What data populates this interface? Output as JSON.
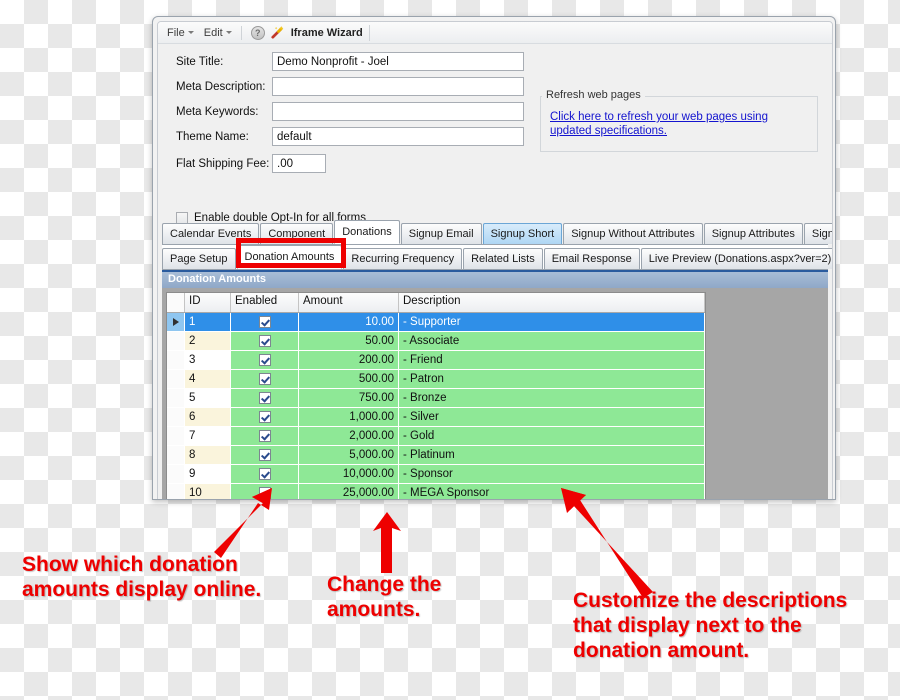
{
  "window": {
    "menu": {
      "file_label": "File",
      "edit_label": "Edit",
      "help_icon_label": "?",
      "wizard_label": "Iframe Wizard"
    },
    "form": {
      "site_title_label": "Site Title:",
      "site_title_value": "Demo Nonprofit - Joel",
      "meta_description_label": "Meta Description:",
      "meta_description_value": "",
      "meta_keywords_label": "Meta Keywords:",
      "meta_keywords_value": "",
      "theme_name_label": "Theme Name:",
      "theme_name_value": "default",
      "flat_shipping_label": "Flat Shipping Fee:",
      "flat_shipping_value": ".00",
      "opt_in_label": "Enable double Opt-In for all forms",
      "opt_in_checked": false
    },
    "refresh_group": {
      "title": "Refresh web pages",
      "link_text": "Click here to refresh your web pages using updated specifications."
    },
    "tabs_primary": [
      {
        "label": "Calendar Events",
        "state": "normal"
      },
      {
        "label": "Component",
        "state": "normal"
      },
      {
        "label": "Donations",
        "state": "active"
      },
      {
        "label": "Signup Email",
        "state": "normal"
      },
      {
        "label": "Signup Short",
        "state": "hover"
      },
      {
        "label": "Signup Without Attributes",
        "state": "normal"
      },
      {
        "label": "Signup Attributes",
        "state": "normal"
      },
      {
        "label": "Signup Post",
        "state": "normal"
      }
    ],
    "tabs_secondary": [
      {
        "label": "Page Setup",
        "state": "normal"
      },
      {
        "label": "Donation Amounts",
        "state": "active"
      },
      {
        "label": "Recurring Frequency",
        "state": "normal"
      },
      {
        "label": "Related Lists",
        "state": "normal"
      },
      {
        "label": "Email Response",
        "state": "normal"
      },
      {
        "label": "Live Preview (Donations.aspx?ver=2)",
        "state": "normal"
      }
    ],
    "grid": {
      "caption": "Donation Amounts",
      "columns": [
        "ID",
        "Enabled",
        "Amount",
        "Description"
      ],
      "rows": [
        {
          "id": "1",
          "enabled": true,
          "amount": "10.00",
          "description": "- Supporter",
          "selected": true
        },
        {
          "id": "2",
          "enabled": true,
          "amount": "50.00",
          "description": "- Associate",
          "selected": false
        },
        {
          "id": "3",
          "enabled": true,
          "amount": "200.00",
          "description": "- Friend",
          "selected": false
        },
        {
          "id": "4",
          "enabled": true,
          "amount": "500.00",
          "description": "- Patron",
          "selected": false
        },
        {
          "id": "5",
          "enabled": true,
          "amount": "750.00",
          "description": "- Bronze",
          "selected": false
        },
        {
          "id": "6",
          "enabled": true,
          "amount": "1,000.00",
          "description": "- Silver",
          "selected": false
        },
        {
          "id": "7",
          "enabled": true,
          "amount": "2,000.00",
          "description": "- Gold",
          "selected": false
        },
        {
          "id": "8",
          "enabled": true,
          "amount": "5,000.00",
          "description": "- Platinum",
          "selected": false
        },
        {
          "id": "9",
          "enabled": true,
          "amount": "10,000.00",
          "description": "- Sponsor",
          "selected": false
        },
        {
          "id": "10",
          "enabled": true,
          "amount": "25,000.00",
          "description": "- MEGA Sponsor",
          "selected": false
        }
      ]
    }
  },
  "annotations": {
    "accent_color": "#ee0000",
    "left_note": "Show which donation\namounts display online.",
    "middle_note": "Change the\namounts.",
    "right_note": "Customize the descriptions\nthat display next to the\ndonation amount."
  }
}
